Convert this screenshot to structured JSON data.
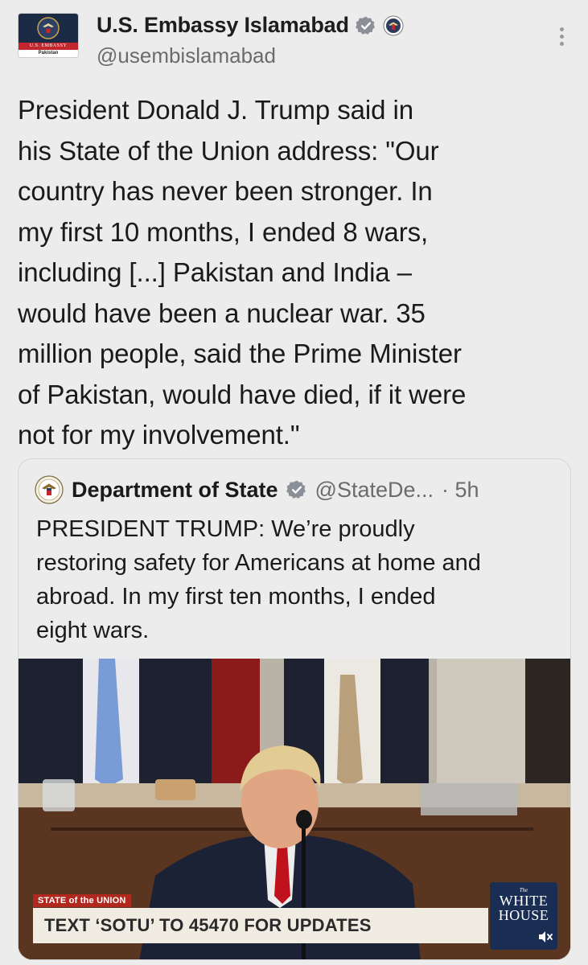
{
  "author": {
    "display_name": "U.S. Embassy Islamabad",
    "handle": "@usembislamabad",
    "avatar_band_text": "U.S. EMBASSY",
    "avatar_country_text": "Pakistan"
  },
  "tweet": {
    "lines": [
      "President Donald J. Trump said in",
      "his State of the Union address: \"Our",
      "country has never been stronger. In",
      "my first 10 months, I ended 8 wars,",
      "including [...] Pakistan and India –",
      "would have been a nuclear war. 35",
      "million people, said the Prime Minister",
      "of Pakistan, would have died, if it were",
      "not for my involvement.\""
    ]
  },
  "quoted": {
    "display_name": "Department of State",
    "handle": "@StateDe...",
    "time": "· 5h",
    "lines": [
      "PRESIDENT TRUMP: We’re proudly",
      "restoring safety for Americans at home and",
      "abroad. In my first ten months, I ended",
      "eight wars."
    ],
    "media": {
      "tag": "STATE of the UNION",
      "banner": "TEXT ‘SOTU’ TO 45470 FOR UPDATES",
      "logo_small": "The",
      "logo_line1": "WHITE",
      "logo_line2": "HOUSE"
    }
  },
  "icons": {
    "verified": "verified-badge-icon",
    "affiliation": "government-seal-icon",
    "more": "more-options-icon",
    "mute": "mute-speaker-icon"
  },
  "colors": {
    "background": "#ececec",
    "verified_badge": "#8a8f98",
    "sotu_red": "#b0281e",
    "white_house_navy": "#1a2d52"
  }
}
